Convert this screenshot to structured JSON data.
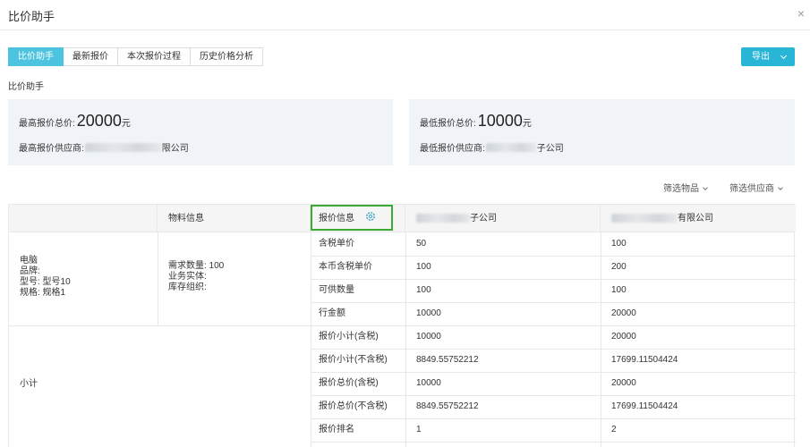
{
  "window": {
    "title": "比价助手",
    "close_glyph": "×"
  },
  "tabs": [
    {
      "label": "比价助手",
      "active": true
    },
    {
      "label": "最新报价",
      "active": false
    },
    {
      "label": "本次报价过程",
      "active": false
    },
    {
      "label": "历史价格分析",
      "active": false
    }
  ],
  "export_button": {
    "label": "导出"
  },
  "section_label": "比价助手",
  "summary": {
    "highest": {
      "total_label": "最高报价总价:",
      "total_value": "20000",
      "unit": "元",
      "supplier_label": "最高报价供应商:",
      "supplier_suffix": "限公司"
    },
    "lowest": {
      "total_label": "最低报价总价:",
      "total_value": "10000",
      "unit": "元",
      "supplier_label": "最低报价供应商:",
      "supplier_suffix": "子公司"
    }
  },
  "filters": {
    "material": "筛选物品",
    "supplier": "筛选供应商"
  },
  "table": {
    "headers": {
      "material_info": "物料信息",
      "quote_info": "报价信息",
      "supplier_a_suffix": "子公司",
      "supplier_b_suffix": "有限公司"
    },
    "item": {
      "name": "电脑",
      "brand": "品牌:",
      "model": "型号: 型号10",
      "spec": "规格: 规格1"
    },
    "material": {
      "qty": "需求数量: 100",
      "entity": "业务实体:",
      "org": "库存组织:"
    },
    "subtotal_label": "小计",
    "rows": [
      {
        "label": "含税单价",
        "a": "50",
        "b": "100"
      },
      {
        "label": "本币含税单价",
        "a": "100",
        "b": "200"
      },
      {
        "label": "可供数量",
        "a": "100",
        "b": "100"
      },
      {
        "label": "行金额",
        "a": "10000",
        "b": "20000"
      },
      {
        "label": "报价小计(含税)",
        "a": "10000",
        "b": "20000"
      },
      {
        "label": "报价小计(不含税)",
        "a": "8849.55752212",
        "b": "17699.11504424"
      },
      {
        "label": "报价总价(含税)",
        "a": "10000",
        "b": "20000"
      },
      {
        "label": "报价总价(不含税)",
        "a": "8849.55752212",
        "b": "17699.11504424"
      },
      {
        "label": "报价排名",
        "a": "1",
        "b": "2"
      }
    ]
  },
  "icons": {
    "close": "close-icon",
    "chevron": "chevron-down-icon",
    "gear": "gear-icon"
  }
}
